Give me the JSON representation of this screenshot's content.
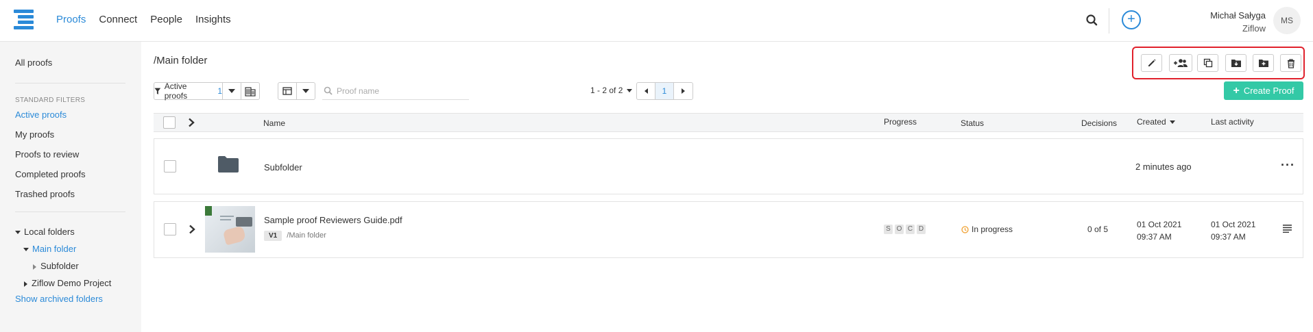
{
  "nav": {
    "items": [
      {
        "label": "Proofs",
        "active": true
      },
      {
        "label": "Connect",
        "active": false
      },
      {
        "label": "People",
        "active": false
      },
      {
        "label": "Insights",
        "active": false
      }
    ]
  },
  "user": {
    "name": "Michał Sałyga",
    "org": "Ziflow",
    "initials": "MS"
  },
  "sidebar": {
    "all_proofs": "All proofs",
    "standard_filters_heading": "STANDARD FILTERS",
    "filters": [
      "Active proofs",
      "My proofs",
      "Proofs to review",
      "Completed proofs",
      "Trashed proofs"
    ],
    "local_folders": "Local folders",
    "main_folder": "Main folder",
    "subfolder": "Subfolder",
    "demo_project": "Ziflow Demo Project",
    "show_archived": "Show archived folders"
  },
  "main": {
    "breadcrumb": "/Main folder",
    "filter_label": "Active proofs",
    "filter_count": "1",
    "search_placeholder": "Proof name",
    "page_count": "1 - 2 of 2",
    "current_page": "1",
    "create_button": "Create Proof"
  },
  "table": {
    "headers": {
      "name": "Name",
      "progress": "Progress",
      "status": "Status",
      "decisions": "Decisions",
      "created": "Created",
      "last_activity": "Last activity"
    },
    "folder_row": {
      "name": "Subfolder",
      "created": "2 minutes ago"
    },
    "proof_row": {
      "name": "Sample proof Reviewers Guide.pdf",
      "version": "V1",
      "path": "/Main folder",
      "progress_letters": [
        "S",
        "O",
        "C",
        "D"
      ],
      "status": "In progress",
      "decisions": "0 of 5",
      "created_date": "01 Oct 2021",
      "created_time": "09:37 AM",
      "activity_date": "01 Oct 2021",
      "activity_time": "09:37 AM"
    }
  },
  "colors": {
    "accent": "#2b8ad8",
    "create": "#33c9a6",
    "highlight": "#e0202b",
    "in_progress": "#f0a030"
  }
}
